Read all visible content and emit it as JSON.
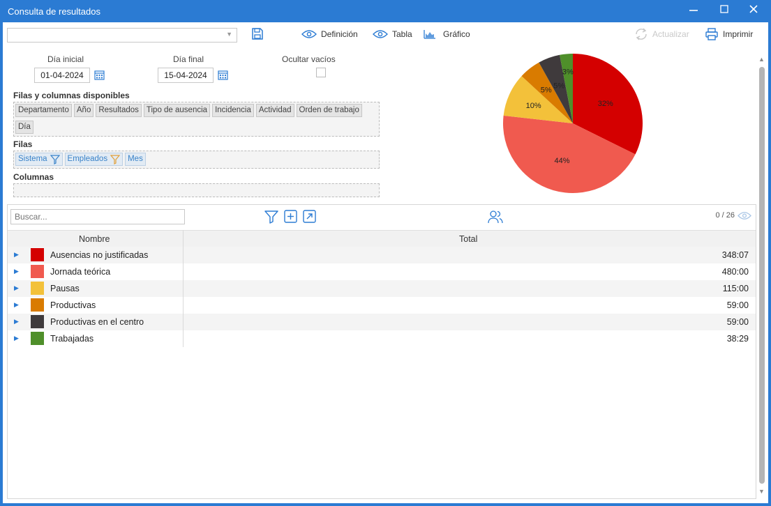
{
  "window": {
    "title": "Consulta de resultados",
    "controls": [
      "minimize-icon",
      "maximize-icon",
      "close-icon"
    ]
  },
  "toolbar": {
    "combo_value": "",
    "definicion_label": "Definición",
    "tabla_label": "Tabla",
    "grafico_label": "Gráfico",
    "actualizar_label": "Actualizar",
    "imprimir_label": "Imprimir"
  },
  "filters": {
    "dia_inicial_label": "Día inicial",
    "dia_inicial_value": "01-04-2024",
    "dia_final_label": "Día final",
    "dia_final_value": "15-04-2024",
    "ocultar_vacios_label": "Ocultar vacíos",
    "ocultar_vacios_checked": false
  },
  "available": {
    "title": "Filas y columnas disponibles",
    "items": [
      "Departamento",
      "Año",
      "Resultados",
      "Tipo de ausencia",
      "Incidencia",
      "Actividad",
      "Orden de trabajo",
      "Día"
    ]
  },
  "rows_section": {
    "title": "Filas",
    "items": [
      {
        "label": "Sistema",
        "filter": true
      },
      {
        "label": "Empleados",
        "filter": true
      },
      {
        "label": "Mes",
        "filter": false
      }
    ]
  },
  "columns_section": {
    "title": "Columnas",
    "items": []
  },
  "grid": {
    "search_placeholder": "Buscar...",
    "counter": "0 / 26",
    "col_nombre": "Nombre",
    "col_total": "Total",
    "rows": [
      {
        "name": "Ausencias no justificadas",
        "total": "348:07",
        "color": "#d40000"
      },
      {
        "name": "Jornada teórica",
        "total": "480:00",
        "color": "#f05a4f"
      },
      {
        "name": "Pausas",
        "total": "115:00",
        "color": "#f3c13a"
      },
      {
        "name": "Productivas",
        "total": "59:00",
        "color": "#d97b00"
      },
      {
        "name": "Productivas en el centro",
        "total": "59:00",
        "color": "#3f3a3c"
      },
      {
        "name": "Trabajadas",
        "total": "38:29",
        "color": "#4f8f2a"
      }
    ]
  },
  "chart_data": {
    "type": "pie",
    "slices": [
      {
        "label": "32%",
        "value": 32,
        "color": "#d40000"
      },
      {
        "label": "44%",
        "value": 44,
        "color": "#f05a4f"
      },
      {
        "label": "10%",
        "value": 10,
        "color": "#f3c13a"
      },
      {
        "label": "5%",
        "value": 5,
        "color": "#d97b00"
      },
      {
        "label": "5%",
        "value": 5,
        "color": "#3f3a3c"
      },
      {
        "label": "3%",
        "value": 3,
        "color": "#4f8f2a"
      }
    ]
  },
  "colors": {
    "accent": "#2b7bd3"
  }
}
